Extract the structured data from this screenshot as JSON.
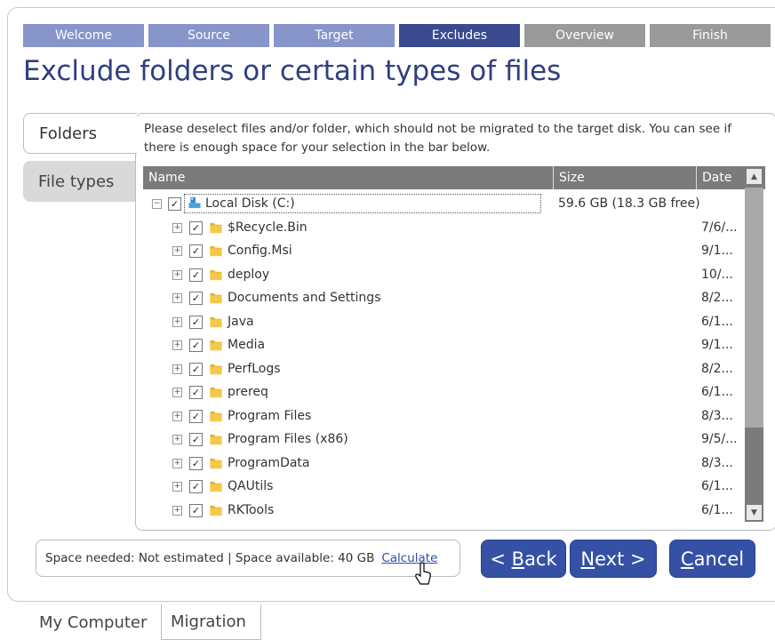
{
  "wizard": {
    "steps": [
      {
        "label": "Welcome",
        "state": "done"
      },
      {
        "label": "Source",
        "state": "done"
      },
      {
        "label": "Target",
        "state": "done"
      },
      {
        "label": "Excludes",
        "state": "active"
      },
      {
        "label": "Overview",
        "state": "todo"
      },
      {
        "label": "Finish",
        "state": "todo"
      }
    ],
    "title": "Exclude folders or certain types of files"
  },
  "side_tabs": [
    {
      "label": "Folders",
      "active": true
    },
    {
      "label": "File types",
      "active": false
    }
  ],
  "description": "Please deselect files and/or folder, which should not be migrated to the target disk. You can see if there is enough space for your selection in the bar below.",
  "tree": {
    "columns": {
      "name": "Name",
      "size": "Size",
      "date": "Date"
    },
    "root": {
      "name": "Local Disk (C:)",
      "size": "59.6 GB (18.3 GB free)",
      "checked": true,
      "icon": "disk-icon"
    },
    "items": [
      {
        "name": "$Recycle.Bin",
        "date": "7/6/...",
        "checked": true
      },
      {
        "name": "Config.Msi",
        "date": "9/1...",
        "checked": true
      },
      {
        "name": "deploy",
        "date": "10/...",
        "checked": true
      },
      {
        "name": "Documents and Settings",
        "date": "8/2...",
        "checked": true
      },
      {
        "name": "Java",
        "date": "6/1...",
        "checked": true
      },
      {
        "name": "Media",
        "date": "9/1...",
        "checked": true
      },
      {
        "name": "PerfLogs",
        "date": "8/2...",
        "checked": true
      },
      {
        "name": "prereq",
        "date": "6/1...",
        "checked": true
      },
      {
        "name": "Program Files",
        "date": "8/3...",
        "checked": true
      },
      {
        "name": "Program Files (x86)",
        "date": "9/5/...",
        "checked": true
      },
      {
        "name": "ProgramData",
        "date": "8/3...",
        "checked": true
      },
      {
        "name": "QAUtils",
        "date": "6/1...",
        "checked": true
      },
      {
        "name": "RKTools",
        "date": "6/1...",
        "checked": true
      }
    ]
  },
  "space_bar": {
    "text": "Space needed: Not estimated | Space available: 40 GB",
    "link": "Calculate"
  },
  "buttons": {
    "back": {
      "prefix": "< ",
      "accel": "B",
      "rest": "ack"
    },
    "next": {
      "accel": "N",
      "rest": "ext >"
    },
    "cancel": {
      "accel": "C",
      "rest": "ancel"
    }
  },
  "bottom_tabs": [
    {
      "label": "My Computer",
      "active": false
    },
    {
      "label": "Migration",
      "active": true
    }
  ],
  "colors": {
    "accent": "#3551a6",
    "step_active": "#3a4a8f",
    "step_done": "#8795cb",
    "step_todo": "#9a9a9a"
  }
}
